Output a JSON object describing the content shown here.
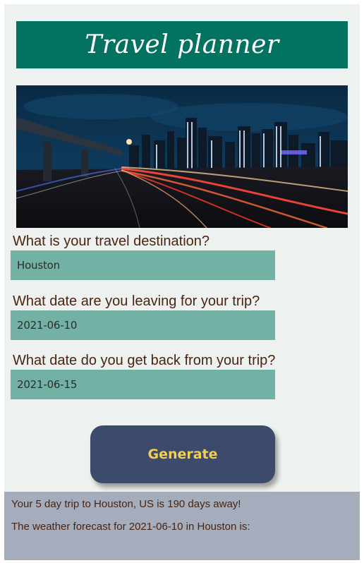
{
  "header": {
    "title": "Travel planner"
  },
  "hero_image": {
    "description_icon": "city-skyline-night-image"
  },
  "form": {
    "destination": {
      "label": "What is your travel destination?",
      "value": "Houston"
    },
    "departure": {
      "label": "What date are you leaving for your trip?",
      "value": "2021-06-10"
    },
    "return": {
      "label": "What date do you get back from your trip?",
      "value": "2021-06-15"
    },
    "generate_label": "Generate"
  },
  "results": {
    "summary": "Your 5 day trip to Houston, US is 190 days away!",
    "forecast": "The weather forecast for 2021-06-10 in Houston is:"
  },
  "colors": {
    "header_bg": "#037260",
    "field_bg": "#74b1a5",
    "button_bg": "#3c4a6b",
    "button_text": "#f2cf4f",
    "results_bg": "#a5acbb",
    "label_text": "#4a2411"
  }
}
